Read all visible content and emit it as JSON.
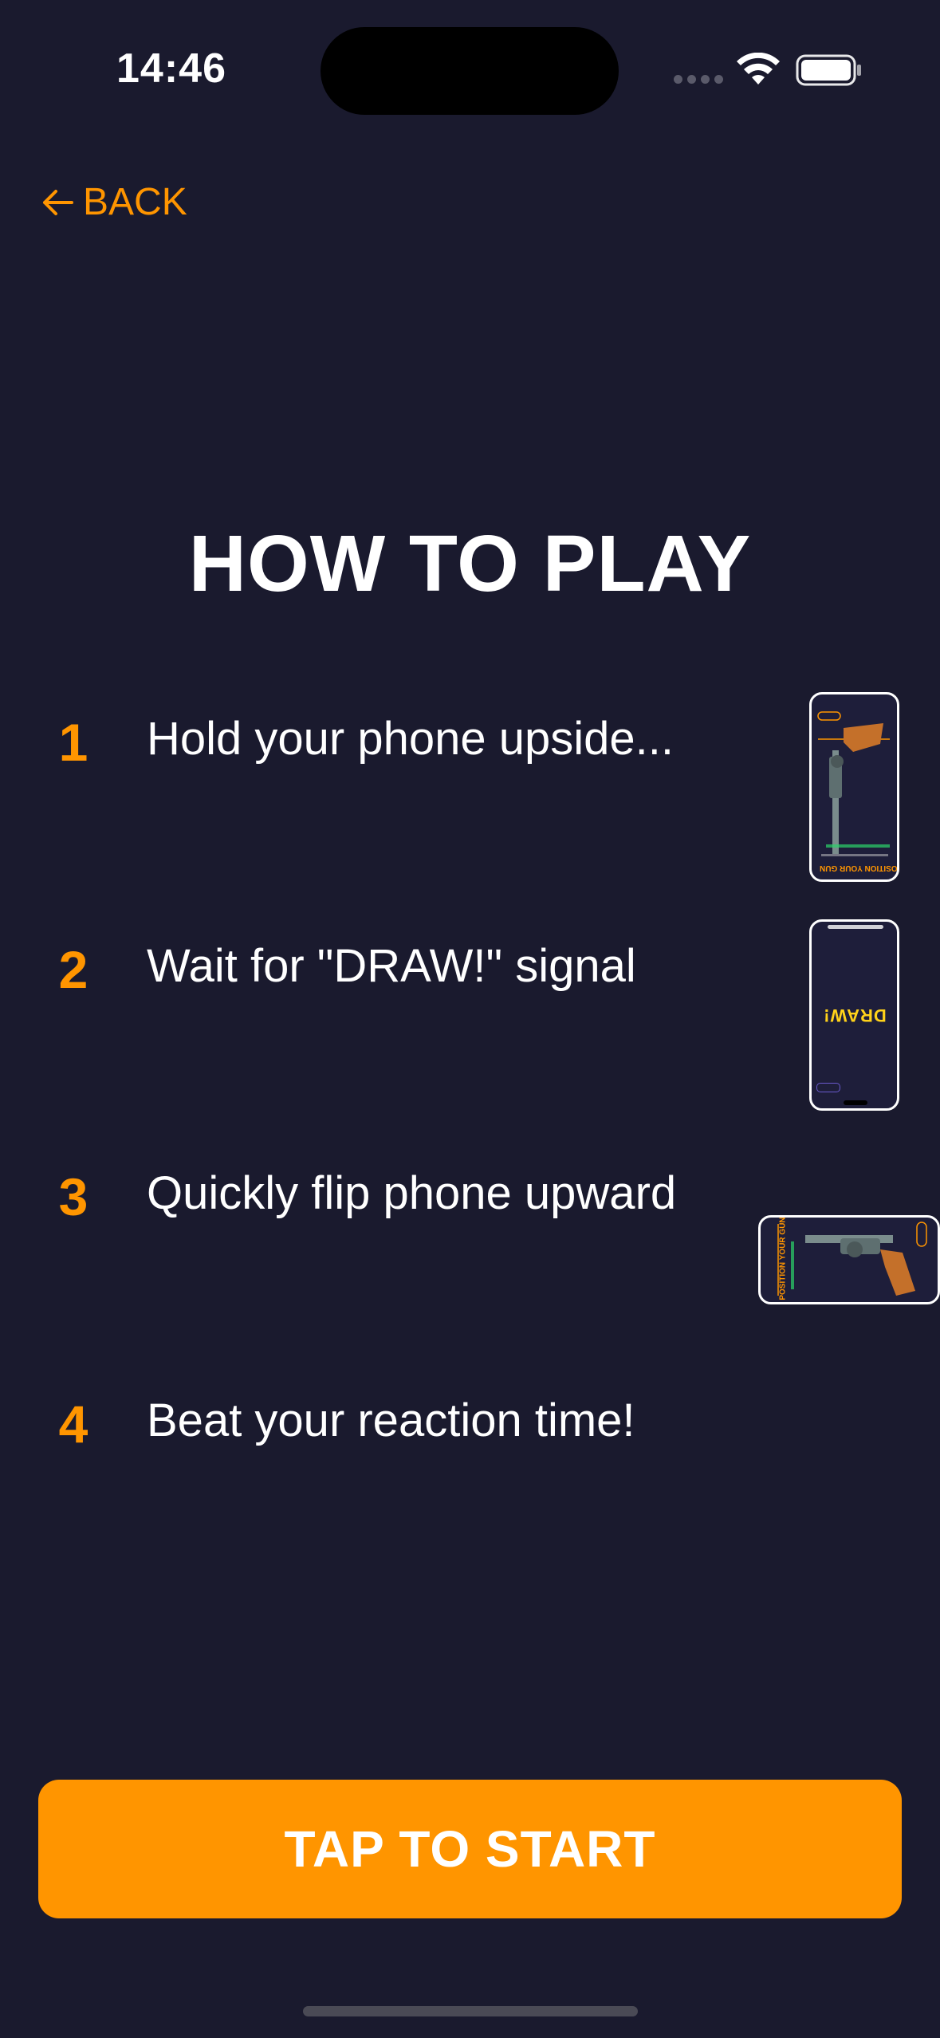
{
  "status_bar": {
    "time": "14:46"
  },
  "nav": {
    "back_label": "BACK"
  },
  "title": "HOW TO PLAY",
  "steps": [
    {
      "number": "1",
      "text": "Hold your phone upside..."
    },
    {
      "number": "2",
      "text": "Wait for \"DRAW!\" signal"
    },
    {
      "number": "3",
      "text": "Quickly flip phone upward"
    },
    {
      "number": "4",
      "text": "Beat your reaction time!"
    }
  ],
  "thumbnails": {
    "phone_1_caption": "POSITION YOUR GUN",
    "phone_2_signal": "DRAW!",
    "phone_3_caption": "POSITION YOUR GUN"
  },
  "start_button": {
    "label": "TAP TO START"
  },
  "colors": {
    "background": "#1a1a2e",
    "accent": "#ff9500",
    "text": "#ffffff",
    "signal": "#ffd21a"
  }
}
